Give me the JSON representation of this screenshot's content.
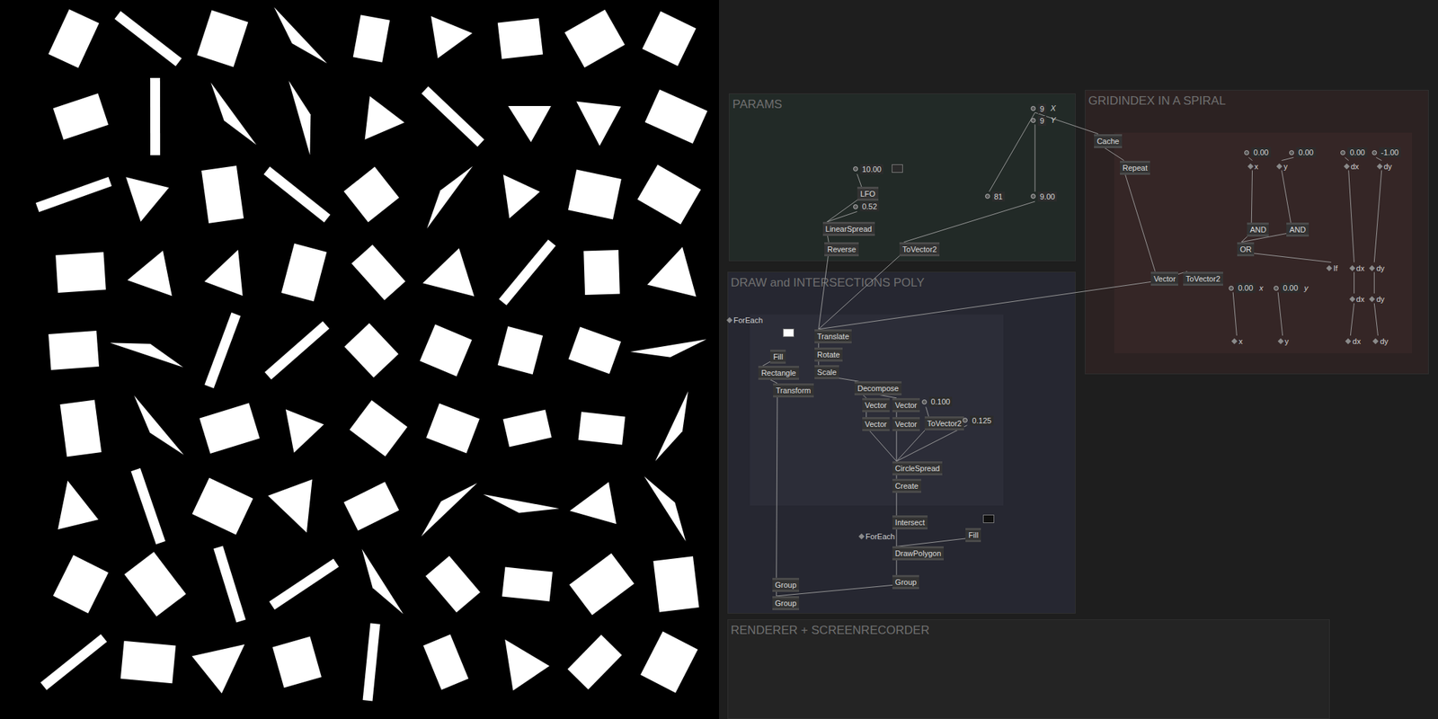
{
  "render": {
    "name": "Renderer output"
  },
  "groups": [
    {
      "title": "PARAMS"
    },
    {
      "title": "GRIDINDEX IN A SPIRAL"
    },
    {
      "title": "DRAW and INTERSECTIONS POLY"
    },
    {
      "title": "RENDERER + SCREENRECORDER"
    }
  ],
  "nodes": [
    {
      "label": "9",
      "kind": "value",
      "suffix": "X"
    },
    {
      "label": "9",
      "kind": "value",
      "suffix": "Y"
    },
    {
      "label": "81",
      "kind": "value",
      "suffix": ""
    },
    {
      "label": "9.00",
      "kind": "value",
      "suffix": ""
    },
    {
      "label": "10.00",
      "kind": "value",
      "suffix": ""
    },
    {
      "label": "LFO",
      "kind": "node",
      "suffix": ""
    },
    {
      "label": "0.52",
      "kind": "value",
      "suffix": ""
    },
    {
      "label": "LinearSpread",
      "kind": "node",
      "suffix": ""
    },
    {
      "label": "Reverse",
      "kind": "node",
      "suffix": ""
    },
    {
      "label": "ToVector2",
      "kind": "node",
      "suffix": ""
    },
    {
      "label": "Cache",
      "kind": "node",
      "suffix": ""
    },
    {
      "label": "Repeat",
      "kind": "node",
      "suffix": ""
    },
    {
      "label": "0.00",
      "kind": "value",
      "suffix": ""
    },
    {
      "label": "0.00",
      "kind": "value",
      "suffix": ""
    },
    {
      "label": "0.00",
      "kind": "value",
      "suffix": ""
    },
    {
      "label": "-1.00",
      "kind": "value",
      "suffix": ""
    },
    {
      "label": "x",
      "kind": "pin",
      "suffix": ""
    },
    {
      "label": "y",
      "kind": "pin",
      "suffix": ""
    },
    {
      "label": "dx",
      "kind": "pin",
      "suffix": ""
    },
    {
      "label": "dy",
      "kind": "pin",
      "suffix": ""
    },
    {
      "label": "AND",
      "kind": "node",
      "suffix": ""
    },
    {
      "label": "AND",
      "kind": "node",
      "suffix": ""
    },
    {
      "label": "OR",
      "kind": "node",
      "suffix": ""
    },
    {
      "label": "If",
      "kind": "pin",
      "suffix": ""
    },
    {
      "label": "dx",
      "kind": "pin",
      "suffix": ""
    },
    {
      "label": "dy",
      "kind": "pin",
      "suffix": ""
    },
    {
      "label": "Vector",
      "kind": "node",
      "suffix": ""
    },
    {
      "label": "ToVector2",
      "kind": "node",
      "suffix": ""
    },
    {
      "label": "0.00",
      "kind": "value",
      "suffix": "x"
    },
    {
      "label": "0.00",
      "kind": "value",
      "suffix": "y"
    },
    {
      "label": "dx",
      "kind": "pin",
      "suffix": ""
    },
    {
      "label": "dy",
      "kind": "pin",
      "suffix": ""
    },
    {
      "label": "x",
      "kind": "pin",
      "suffix": ""
    },
    {
      "label": "y",
      "kind": "pin",
      "suffix": ""
    },
    {
      "label": "dx",
      "kind": "pin",
      "suffix": ""
    },
    {
      "label": "dy",
      "kind": "pin",
      "suffix": ""
    },
    {
      "label": "ForEach",
      "kind": "pin",
      "suffix": ""
    },
    {
      "label": "Fill",
      "kind": "node",
      "suffix": ""
    },
    {
      "label": "Rectangle",
      "kind": "node",
      "suffix": ""
    },
    {
      "label": "Transform",
      "kind": "node",
      "suffix": ""
    },
    {
      "label": "Translate",
      "kind": "node",
      "suffix": ""
    },
    {
      "label": "Rotate",
      "kind": "node",
      "suffix": ""
    },
    {
      "label": "Scale",
      "kind": "node",
      "suffix": ""
    },
    {
      "label": "Decompose",
      "kind": "node",
      "suffix": ""
    },
    {
      "label": "Vector",
      "kind": "node",
      "suffix": ""
    },
    {
      "label": "Vector",
      "kind": "node",
      "suffix": ""
    },
    {
      "label": "0.100",
      "kind": "value",
      "suffix": ""
    },
    {
      "label": "Vector",
      "kind": "node",
      "suffix": ""
    },
    {
      "label": "Vector",
      "kind": "node",
      "suffix": ""
    },
    {
      "label": "ToVector2",
      "kind": "node",
      "suffix": ""
    },
    {
      "label": "0.125",
      "kind": "value",
      "suffix": ""
    },
    {
      "label": "CircleSpread",
      "kind": "node",
      "suffix": ""
    },
    {
      "label": "Create",
      "kind": "node",
      "suffix": ""
    },
    {
      "label": "Intersect",
      "kind": "node",
      "suffix": ""
    },
    {
      "label": "ForEach",
      "kind": "pin",
      "suffix": ""
    },
    {
      "label": "Fill",
      "kind": "node",
      "suffix": ""
    },
    {
      "label": "DrawPolygon",
      "kind": "node",
      "suffix": ""
    },
    {
      "label": "Group",
      "kind": "node",
      "suffix": ""
    },
    {
      "label": "Group",
      "kind": "node",
      "suffix": ""
    },
    {
      "label": "Group",
      "kind": "node",
      "suffix": ""
    }
  ],
  "swatches": [
    {
      "name": "fill-color",
      "color": "#ffffff"
    },
    {
      "name": "polygon-color",
      "color": "#101010"
    },
    {
      "name": "lfo-toggle",
      "color": "#2a2a2a"
    }
  ]
}
